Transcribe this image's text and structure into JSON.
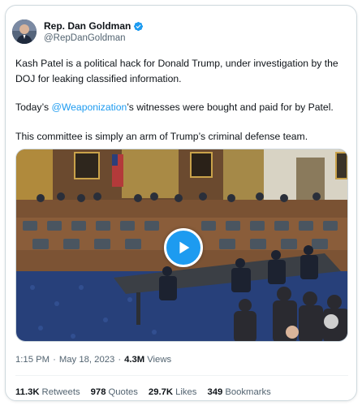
{
  "author": {
    "display_name": "Rep. Dan Goldman",
    "handle": "@RepDanGoldman",
    "verified_icon": "verified-badge-icon",
    "verified_color": "#1d9bf0"
  },
  "tweet": {
    "para1": "Kash Patel is a political hack for Donald Trump, under investigation by the DOJ for leaking classified information.",
    "para2_prefix": "Today’s ",
    "para2_mention": "@Weaponization",
    "para2_suffix": "’s witnesses were bought and paid for by Patel.",
    "para3": "This committee is simply an arm of Trump’s criminal defense team."
  },
  "media": {
    "play_icon": "play-icon",
    "play_color": "#1d9bf0"
  },
  "meta": {
    "time": "1:15 PM",
    "separator": "·",
    "date": "May 18, 2023",
    "views_count": "4.3M",
    "views_label": "Views"
  },
  "stats": {
    "retweets_count": "11.3K",
    "retweets_label": "Retweets",
    "quotes_count": "978",
    "quotes_label": "Quotes",
    "likes_count": "29.7K",
    "likes_label": "Likes",
    "bookmarks_count": "349",
    "bookmarks_label": "Bookmarks"
  },
  "colors": {
    "link": "#1d9bf0",
    "secondary_text": "#536471",
    "border": "#cfd9de"
  }
}
